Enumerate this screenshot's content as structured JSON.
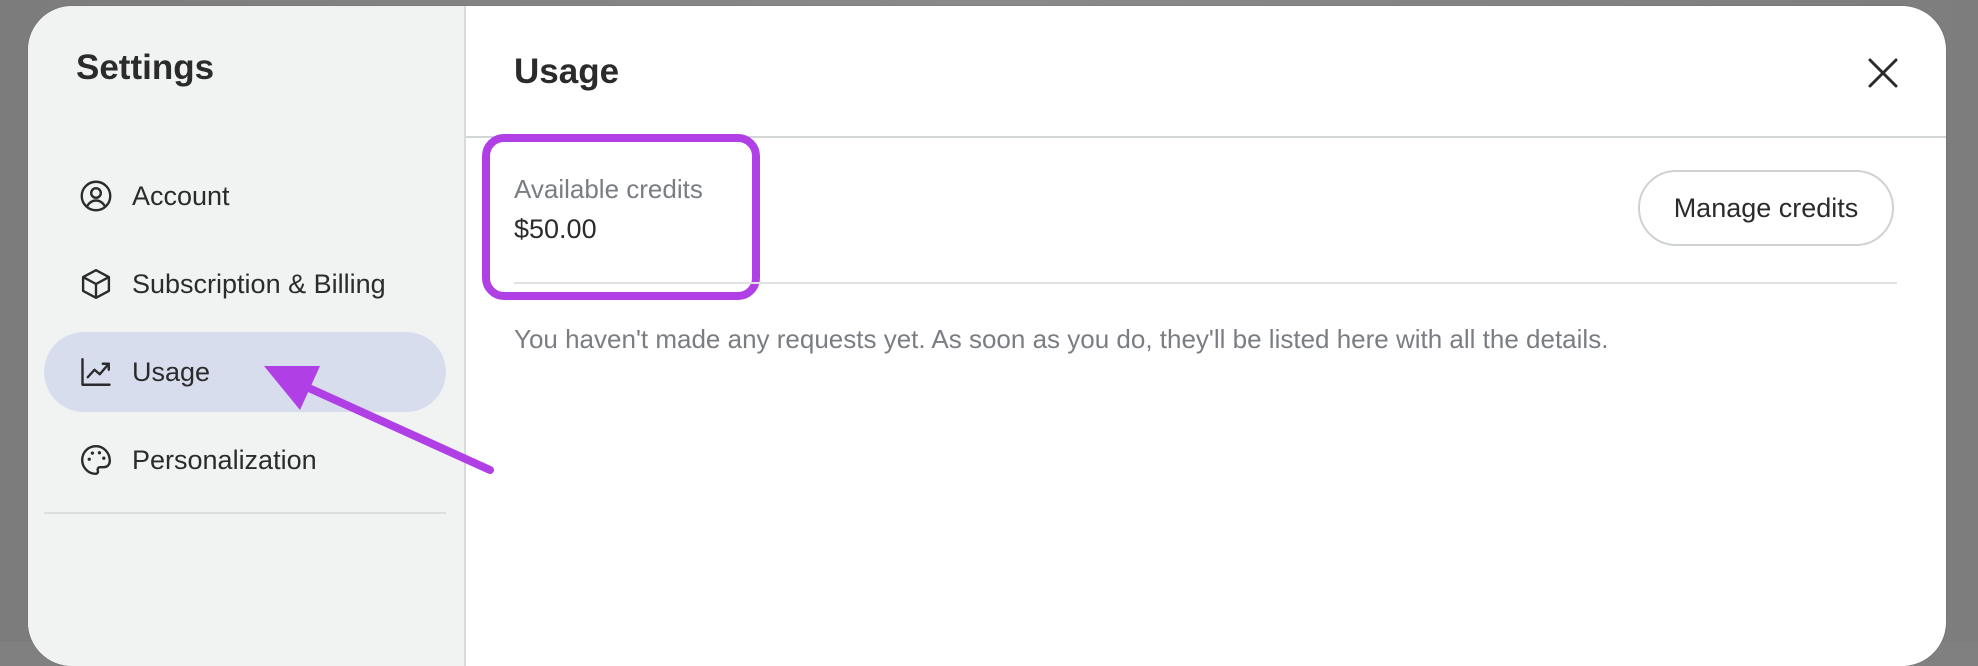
{
  "sidebar": {
    "title": "Settings",
    "items": [
      {
        "label": "Account",
        "icon": "account-circle-icon",
        "active": false
      },
      {
        "label": "Subscription & Billing",
        "icon": "box-icon",
        "active": false
      },
      {
        "label": "Usage",
        "icon": "chart-line-icon",
        "active": true
      },
      {
        "label": "Personalization",
        "icon": "palette-icon",
        "active": false
      }
    ]
  },
  "main": {
    "title": "Usage",
    "credits": {
      "label": "Available credits",
      "value": "$50.00"
    },
    "manage_button": "Manage credits",
    "empty_message": "You haven't made any requests yet. As soon as you do, they'll be listed here with all the details."
  },
  "colors": {
    "highlight": "#b040e6",
    "active_nav_bg": "#d8ddee",
    "sidebar_bg": "#f1f3f3"
  }
}
